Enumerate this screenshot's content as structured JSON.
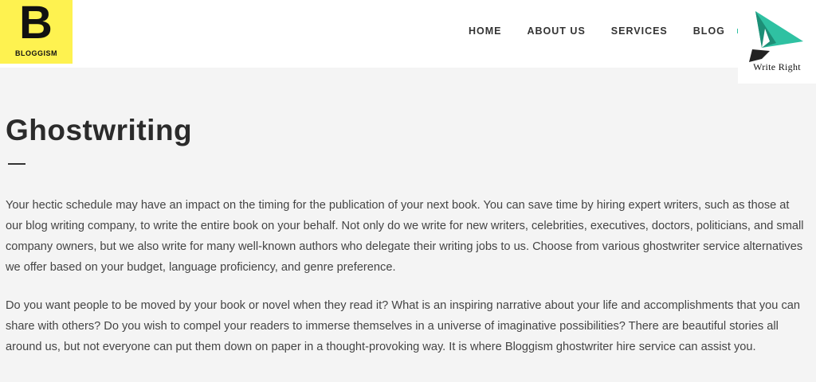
{
  "brand": {
    "logo_letter": "B",
    "logo_name": "BLOGGISM",
    "logo_bg": "#fef250"
  },
  "nav": {
    "items": [
      "HOME",
      "ABOUT US",
      "SERVICES",
      "BLOG"
    ]
  },
  "badge": {
    "label": "Write Right",
    "accent": "#2fc1a2"
  },
  "page": {
    "title": "Ghostwriting",
    "paragraphs": [
      "Your hectic schedule may have an impact on the timing for the publication of your next book. You can save time by hiring expert writers, such as those at our blog writing company, to write the entire book on your behalf. Not only do we write for new writers, celebrities, executives, doctors, politicians, and small company owners, but we also write for many well-known authors who delegate their writing jobs to us. Choose from various ghostwriter service alternatives we offer based on your budget, language proficiency, and genre preference.",
      "Do you want people to be moved by your book or novel when they read it? What is an inspiring narrative about your life and accomplishments that you can share with others? Do you wish to compel your readers to immerse themselves in a universe of imaginative possibilities? There are beautiful stories all around us, but not everyone can put them down on paper in a thought-provoking way. It is where Bloggism ghostwriter hire service can assist you."
    ]
  }
}
